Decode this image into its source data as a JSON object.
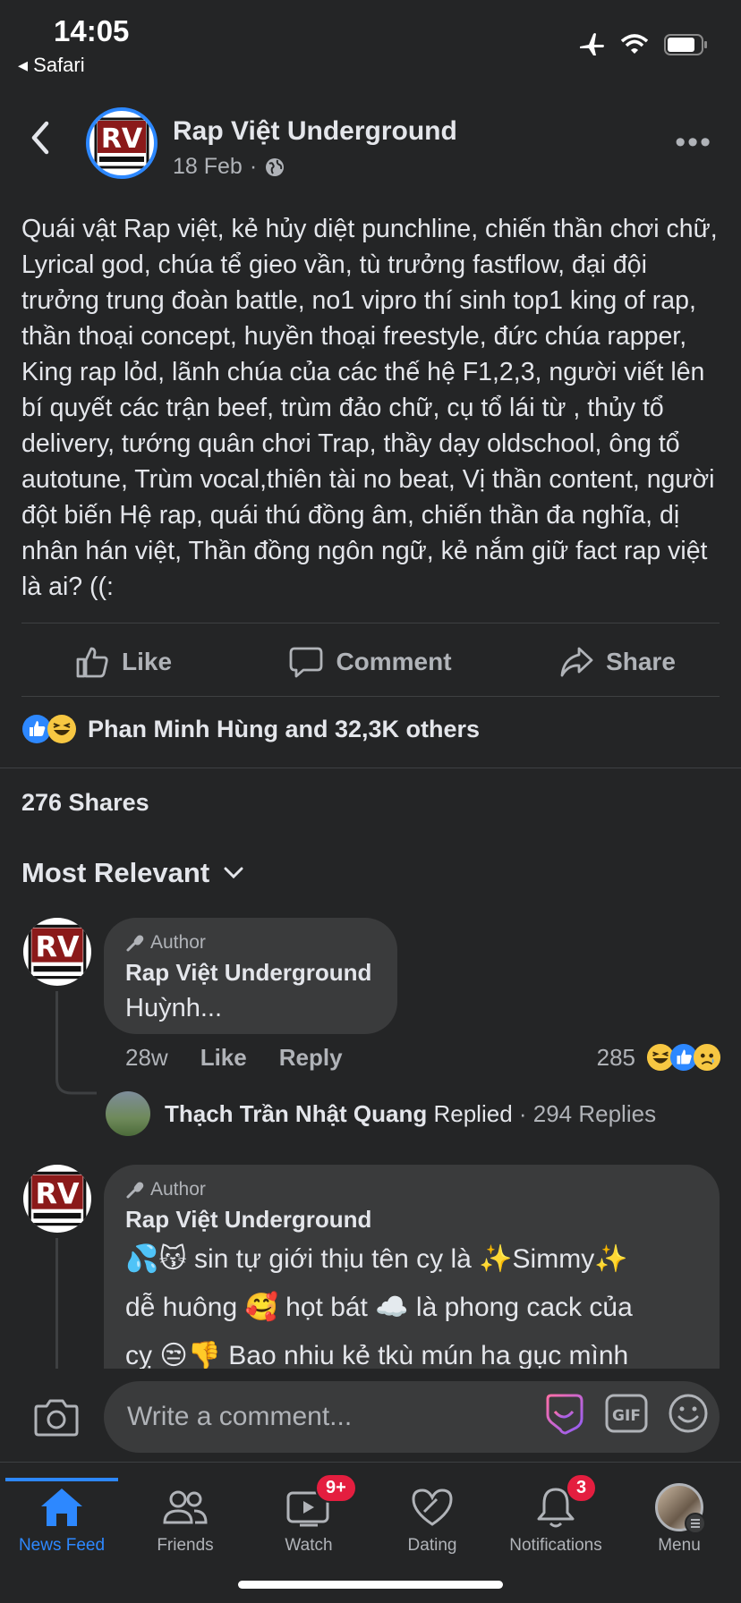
{
  "status": {
    "time": "14:05",
    "back_app": "◂ Safari"
  },
  "post": {
    "page_name": "Rap Việt Underground",
    "date": "18 Feb",
    "avatar_text": "RV",
    "text": "Quái vật Rap việt, kẻ hủy diệt punchline, chiến thần chơi chữ, Lyrical god, chúa tể gieo vần, tù trưởng fastflow, đại đội trưởng trung đoàn battle, no1 vipro thí sinh top1 king of rap, thần thoại concept, huyền thoại freestyle, đức chúa rapper, King rap lỏd, lãnh chúa của các thế hệ F1,2,3, người viết lên bí quyết các trận beef, trùm đảo chữ, cụ tổ lái từ , thủy tổ delivery, tướng quân chơi Trap, thầy dạy oldschool, ông tổ autotune, Trùm vocal,thiên tài no beat, Vị thần content, người đột biến Hệ rap, quái thú đồng âm, chiến thần đa nghĩa, dị nhân hán việt, Thần đồng ngôn ngữ, kẻ nắm giữ fact rap việt là ai? ((:"
  },
  "actions": {
    "like": "Like",
    "comment": "Comment",
    "share": "Share"
  },
  "reactions_summary": "Phan Minh Hùng and 32,3K others",
  "shares": "276 Shares",
  "sort_label": "Most Relevant",
  "comments": [
    {
      "author_tag": "Author",
      "name": "Rap Việt Underground",
      "text": "Huỳnh...",
      "age": "28w",
      "like": "Like",
      "reply": "Reply",
      "reaction_count": "285",
      "reply_summary": {
        "name": "Thạch Trần Nhật Quang",
        "action": "Replied",
        "count": " · 294 Replies"
      }
    },
    {
      "author_tag": "Author",
      "name": "Rap Việt Underground",
      "line1": "💦😽 sin tự giới thịu tên cỵ là ✨Simmy✨",
      "line2": "dễ huông 🥰 họt bát ☁️ là phong cack của",
      "line3": "cỵ 😒👎 Bao nhiu kẻ tkù mún ha gục mình"
    }
  ],
  "comment_input": {
    "placeholder": "Write a comment..."
  },
  "tabs": [
    {
      "label": "News Feed"
    },
    {
      "label": "Friends"
    },
    {
      "label": "Watch",
      "badge": "9+"
    },
    {
      "label": "Dating"
    },
    {
      "label": "Notifications",
      "badge": "3"
    },
    {
      "label": "Menu"
    }
  ],
  "colors": {
    "background": "#242526",
    "accent": "#2d88ff",
    "bubble": "#3a3b3c",
    "badge": "#e41e3f"
  }
}
